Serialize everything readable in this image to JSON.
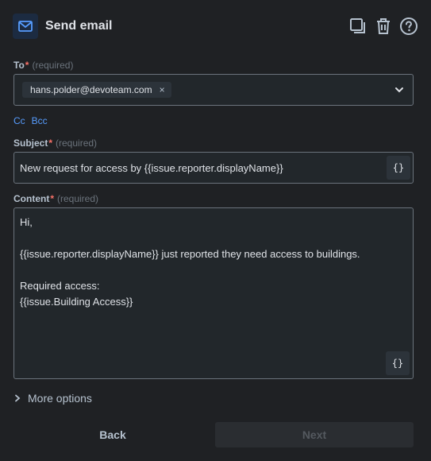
{
  "header": {
    "title": "Send email",
    "app_icon": "mail-icon",
    "actions": [
      "duplicate-icon",
      "trash-icon",
      "help-icon"
    ],
    "accent_color": "#579dff"
  },
  "to": {
    "label": "To",
    "required_mark": "*",
    "required_text": "(required)",
    "recipients": [
      "hans.polder@devoteam.com"
    ],
    "remove_glyph": "×"
  },
  "cc_links": {
    "cc": "Cc",
    "bcc": "Bcc"
  },
  "subject": {
    "label": "Subject",
    "required_mark": "*",
    "required_text": "(required)",
    "value": "New request for access by {{issue.reporter.displayName}}",
    "var_button": "{}"
  },
  "content": {
    "label": "Content",
    "required_mark": "*",
    "required_text": "(required)",
    "lines": [
      "Hi,",
      "",
      "{{issue.reporter.displayName}} just reported they need access to buildings.",
      "",
      "Required access:",
      "{{issue.Building Access}}"
    ],
    "var_button": "{}"
  },
  "more_options": {
    "label": "More options"
  },
  "footer": {
    "back": "Back",
    "next": "Next"
  }
}
